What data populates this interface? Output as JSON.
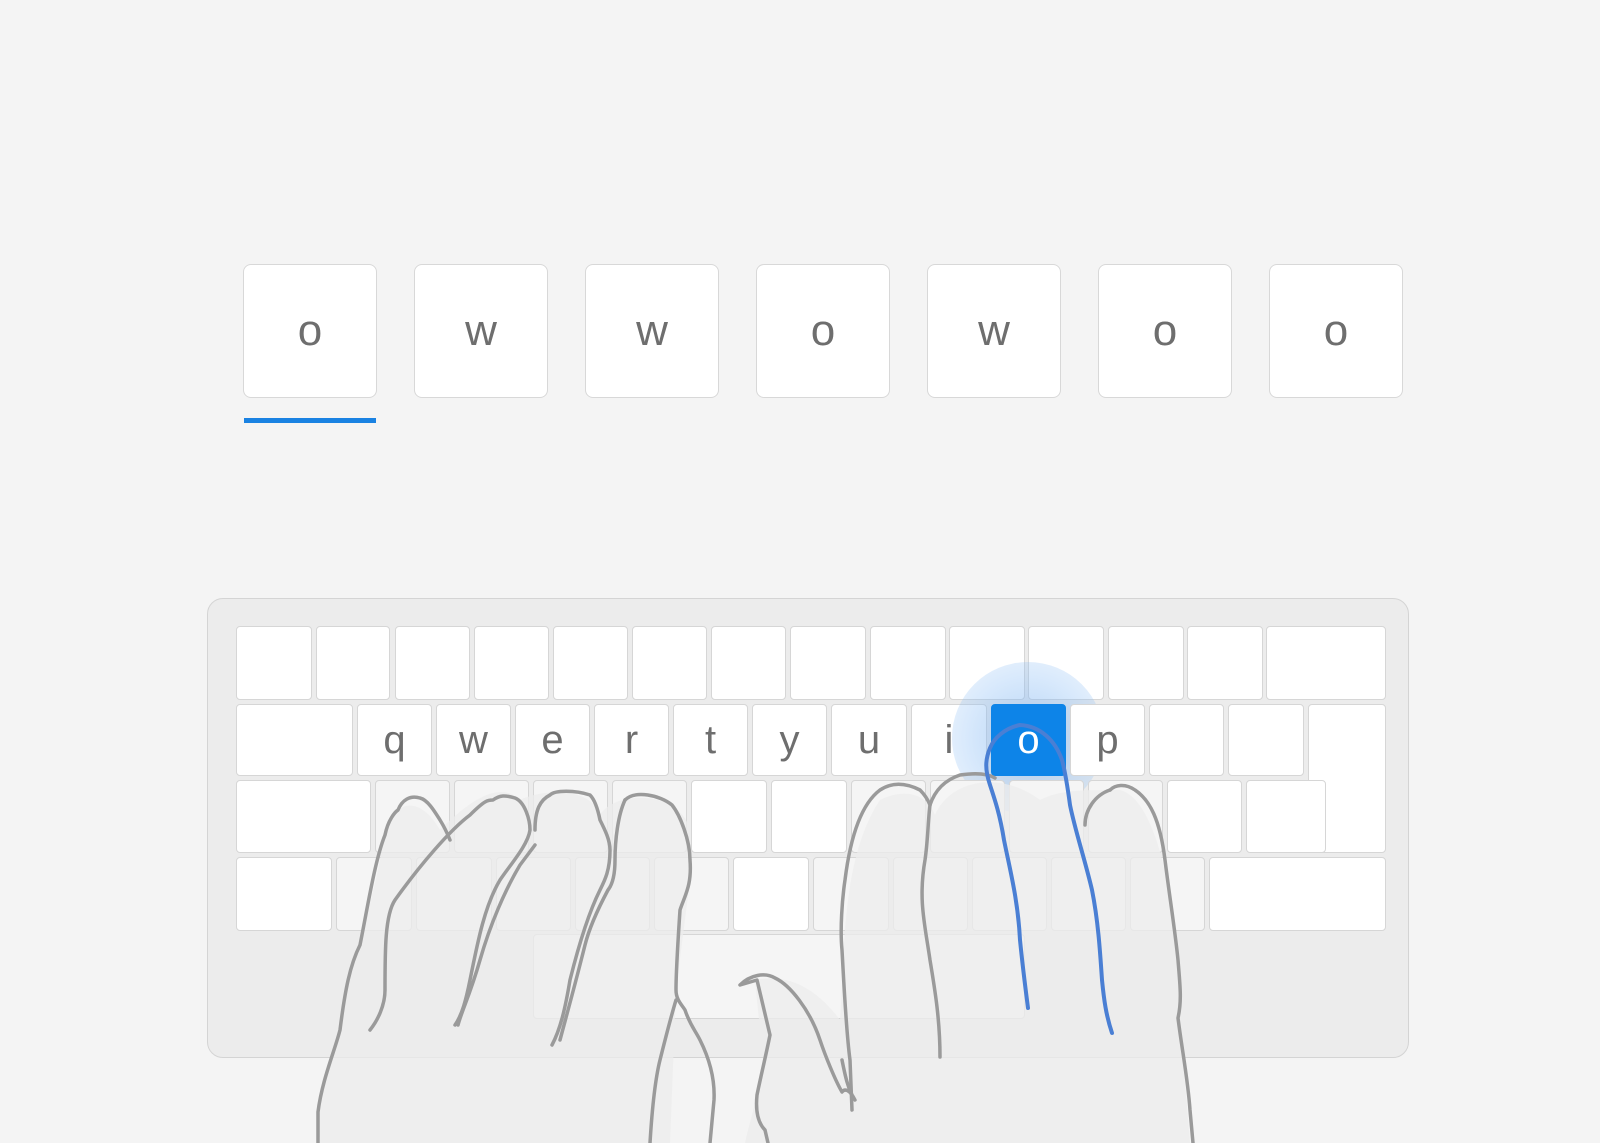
{
  "word": {
    "letters": [
      "o",
      "w",
      "w",
      "o",
      "w",
      "o",
      "o"
    ],
    "current_index": 0
  },
  "keyboard": {
    "row2": [
      "q",
      "w",
      "e",
      "r",
      "t",
      "y",
      "u",
      "i",
      "o",
      "p"
    ],
    "active_key": "o"
  },
  "colors": {
    "accent": "#0d84e8",
    "finger_highlight": "#4a7fd4",
    "hand_outline": "#9a9a9a"
  },
  "icons": {
    "hands": "typing-hands-illustration"
  }
}
